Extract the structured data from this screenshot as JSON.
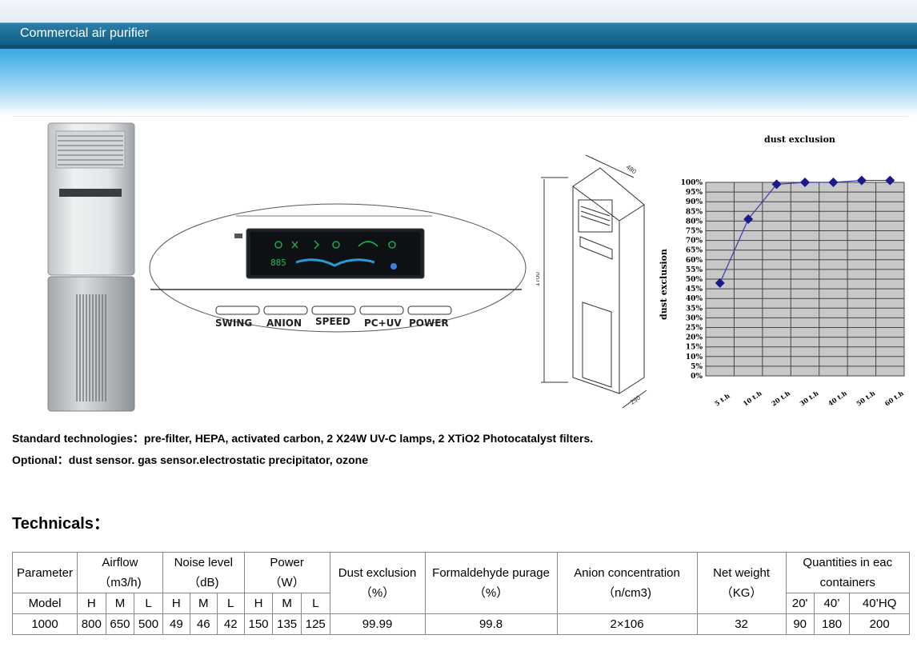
{
  "header": {
    "title": "Commercial air purifier"
  },
  "panel": {
    "display_digits": "885",
    "buttons": [
      "SWING",
      "ANION",
      "SPEED",
      "PC+UV",
      "POWER"
    ]
  },
  "drawing": {
    "dim_depth": "480",
    "dim_height": "1700",
    "dim_width": "290"
  },
  "chart_data": {
    "type": "line",
    "title": "dust exclusion",
    "ylabel": "dust exclusion",
    "xlabel": "",
    "x": [
      "5 t.h",
      "10 t.h",
      "20 t.h",
      "30 t.h",
      "40 t.h",
      "50 t.h",
      "60 t.h"
    ],
    "values": [
      48,
      81,
      99,
      100,
      100,
      101,
      101
    ],
    "ylim": [
      0,
      100
    ],
    "yticks": [
      "0%",
      "5%",
      "10%",
      "15%",
      "20%",
      "25%",
      "30%",
      "35%",
      "40%",
      "45%",
      "50%",
      "55%",
      "60%",
      "65%",
      "70%",
      "75%",
      "80%",
      "85%",
      "90%",
      "95%",
      "100%"
    ],
    "grid": true,
    "color": "#1a1a8c"
  },
  "paragraphs": {
    "standard": "Standard technologies：pre-filter, HEPA, activated carbon, 2 X24W UV-C lamps, 2 XTiO2 Photocatalyst filters.",
    "optional": "Optional：dust sensor. gas sensor.electrostatic precipitator, ozone"
  },
  "technicals": {
    "title": "Technicals：",
    "h_parameter": "Parameter",
    "h_airflow": "Airflow",
    "h_airflow_unit": "（m3/h)",
    "h_noise": "Noise level",
    "h_noise_unit": "（dB)",
    "h_power": "Power",
    "h_power_unit": "（W）",
    "h_dust": "Dust exclusion",
    "h_dust_unit": "（%）",
    "h_form": "Formaldehyde purage",
    "h_form_unit": "（%）",
    "h_anion": "Anion concentration",
    "h_anion_unit": "（n/cm3)",
    "h_weight": "Net weight",
    "h_weight_unit": "（KG）",
    "h_qty": "Quantities in eac",
    "h_qty2": "containers",
    "h_model": "Model",
    "sub_airflow": [
      "H",
      "M",
      "L"
    ],
    "sub_noise": [
      "H",
      "M",
      "L"
    ],
    "sub_power": [
      "H",
      "M",
      "L"
    ],
    "sub_containers": [
      "20'",
      "40’",
      "40’HQ"
    ],
    "row": {
      "model": "1000",
      "airflow": [
        "800",
        "650",
        "500"
      ],
      "noise": [
        "49",
        "46",
        "42"
      ],
      "power": [
        "150",
        "135",
        "125"
      ],
      "dust": "99.99",
      "form": "99.8",
      "anion": "2×106",
      "weight": "32",
      "containers": [
        "90",
        "180",
        "200"
      ]
    }
  }
}
